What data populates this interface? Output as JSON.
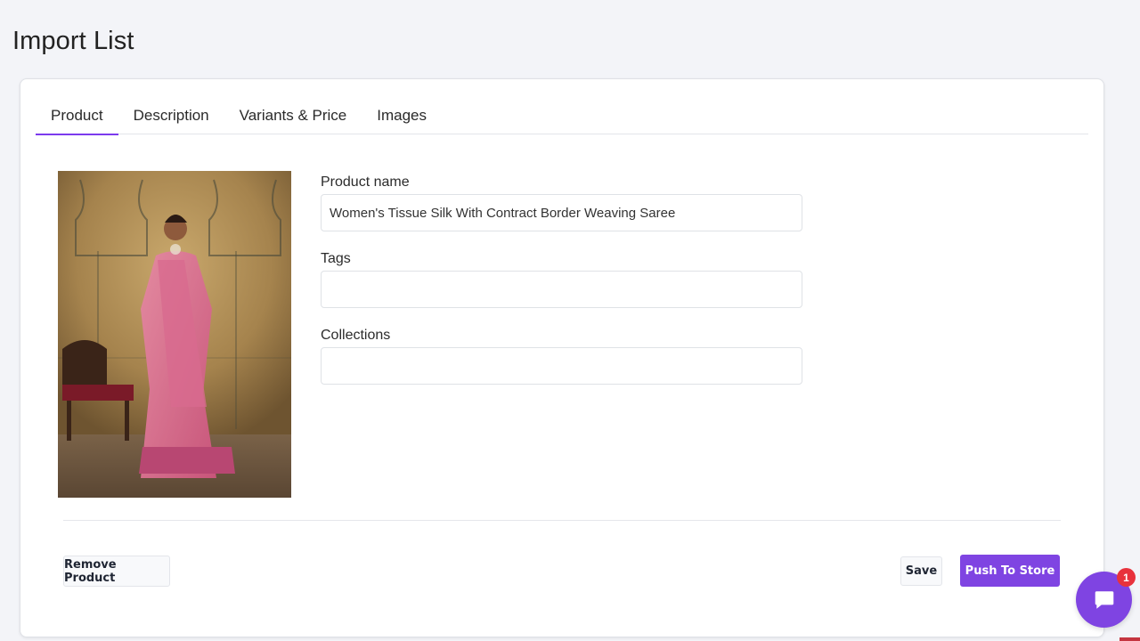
{
  "page": {
    "title": "Import List"
  },
  "tabs": [
    {
      "label": "Product",
      "active": true
    },
    {
      "label": "Description",
      "active": false
    },
    {
      "label": "Variants & Price",
      "active": false
    },
    {
      "label": "Images",
      "active": false
    }
  ],
  "product": {
    "image_alt": "Woman wearing pink tissue silk saree",
    "fields": {
      "name": {
        "label": "Product name",
        "value": "Women's Tissue Silk With Contract Border Weaving Saree",
        "placeholder": ""
      },
      "tags": {
        "label": "Tags",
        "value": "",
        "placeholder": ""
      },
      "collections": {
        "label": "Collections",
        "value": "",
        "placeholder": ""
      }
    }
  },
  "actions": {
    "remove_label": "Remove Product",
    "save_label": "Save",
    "push_label": "Push To Store"
  },
  "chat": {
    "icon": "chat-bubble-icon",
    "badge_count": "1"
  },
  "colors": {
    "accent": "#7f44e2",
    "badge": "#e8323c",
    "background": "#f3f4f8"
  }
}
